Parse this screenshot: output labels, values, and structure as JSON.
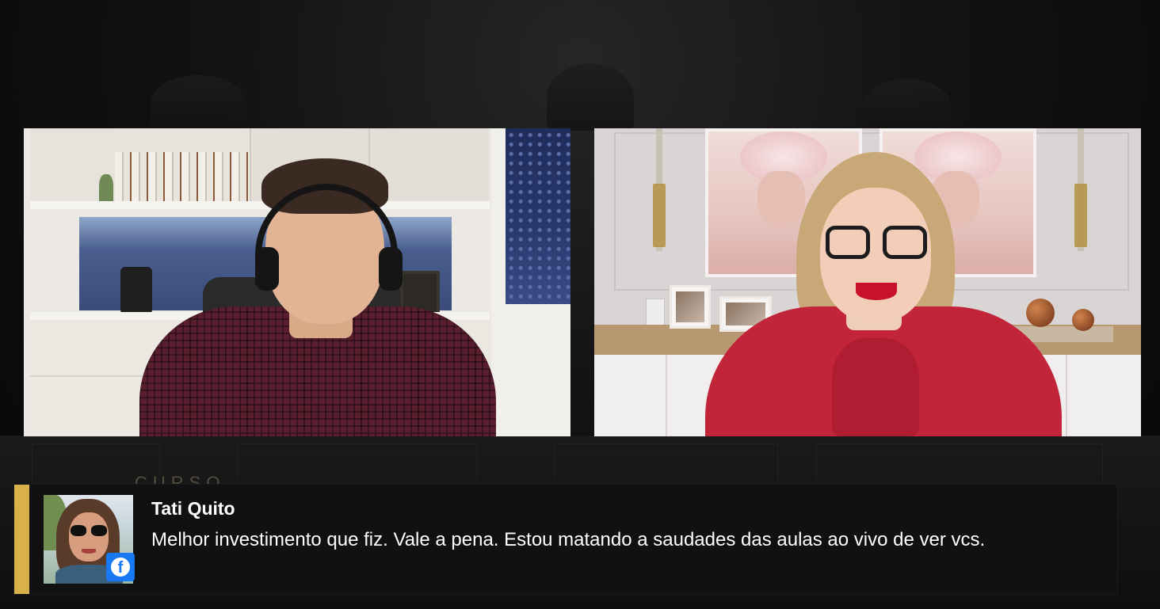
{
  "stream": {
    "watermark": "CURSO",
    "participants": [
      {
        "role": "host-left"
      },
      {
        "role": "host-right"
      }
    ]
  },
  "comment": {
    "author": "Tati Quito",
    "message": "Melhor investimento que fiz. Vale a pena. Estou matando a saudades das aulas ao vivo de ver vcs.",
    "source_icon": "facebook-icon",
    "source_badge_letter": "f",
    "accent_color": "#d8b14a",
    "source_color": "#1877f2"
  }
}
